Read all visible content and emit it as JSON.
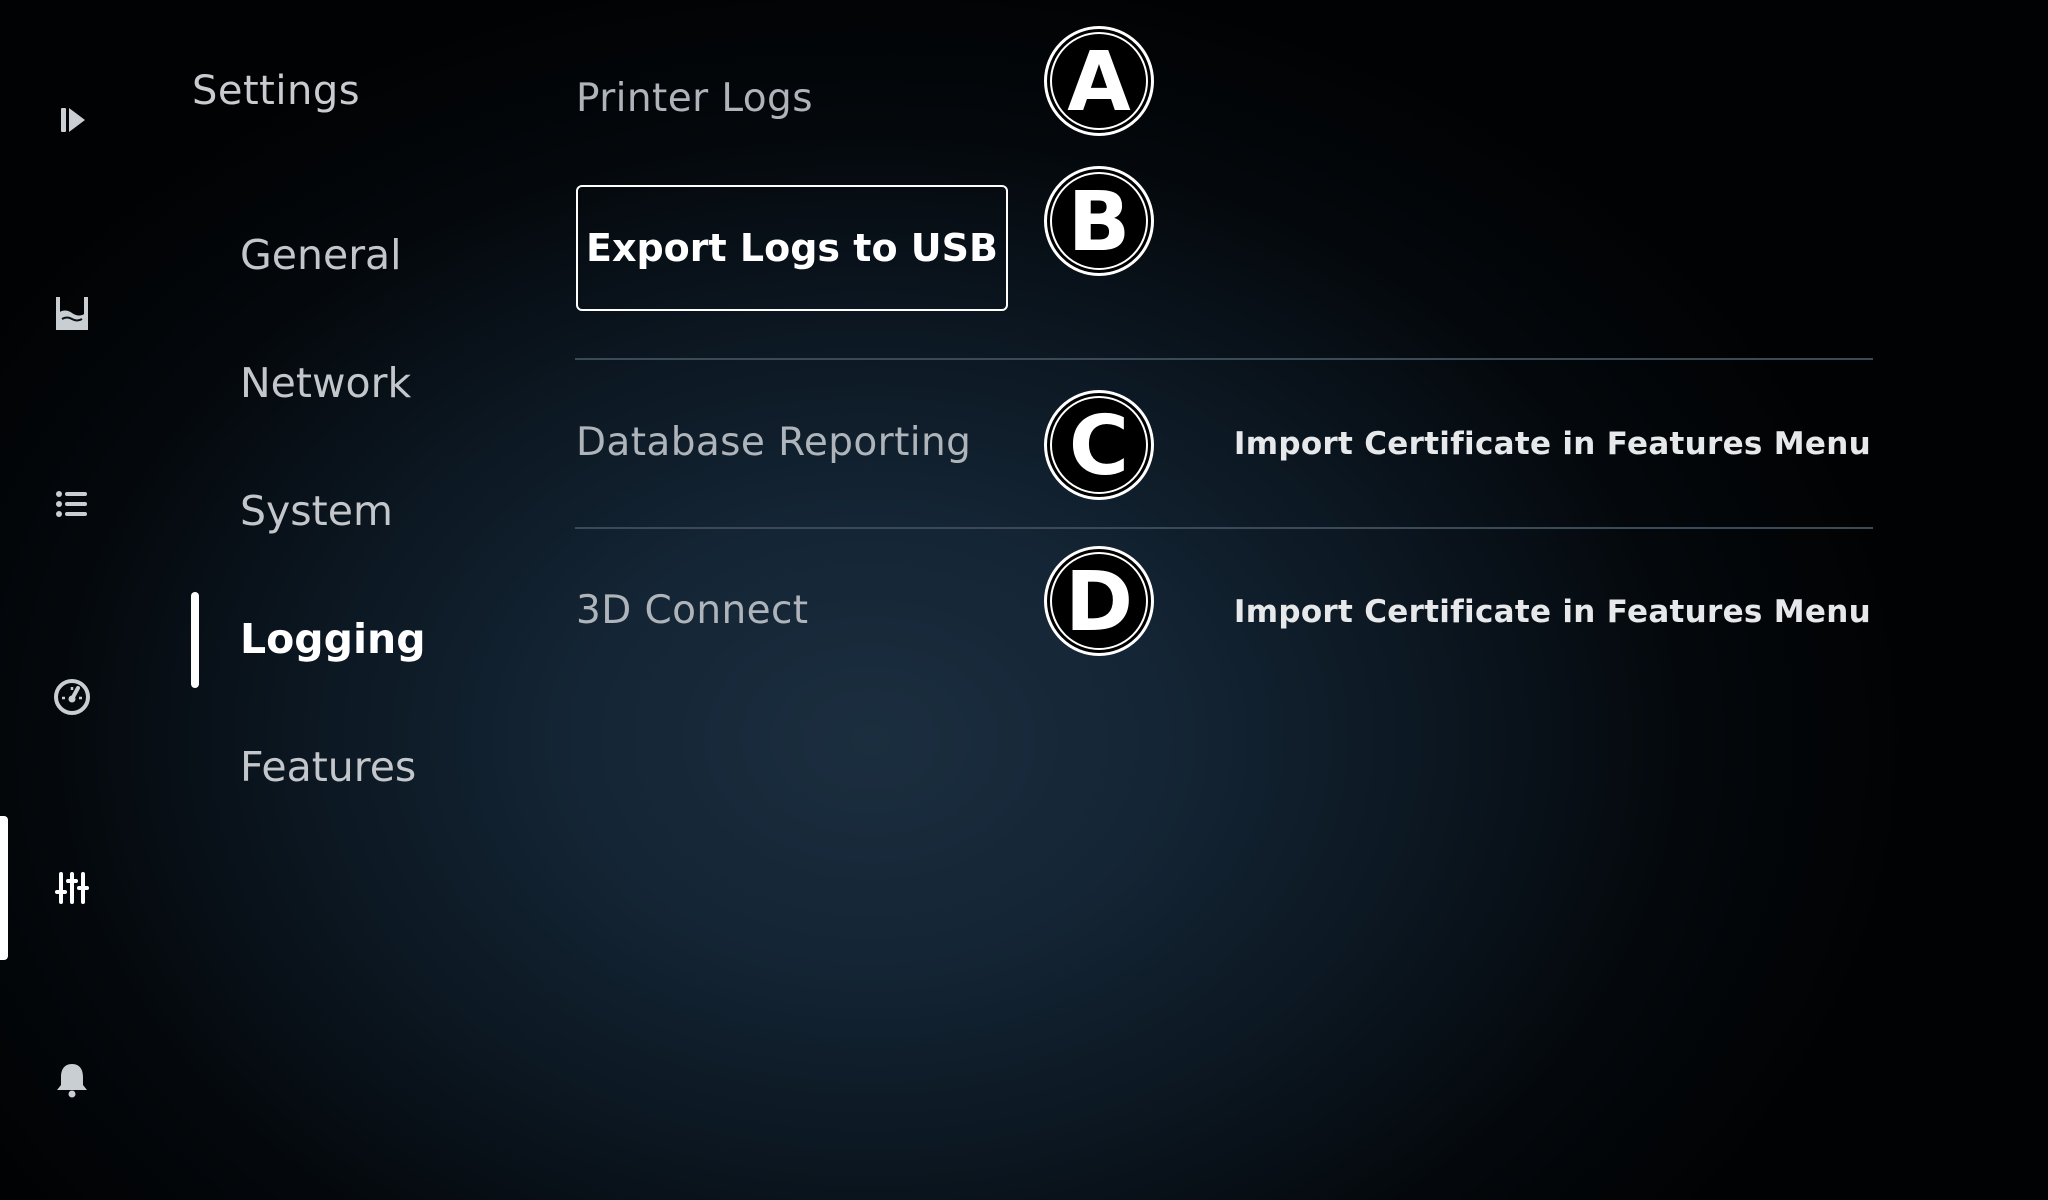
{
  "sidebar_rail": {
    "items": [
      {
        "icon": "play-next-icon"
      },
      {
        "icon": "tank-icon"
      },
      {
        "icon": "list-icon"
      },
      {
        "icon": "gauge-icon"
      },
      {
        "icon": "sliders-icon",
        "active": true
      },
      {
        "icon": "bell-icon"
      }
    ]
  },
  "settings": {
    "title": "Settings",
    "nav": [
      {
        "label": "General"
      },
      {
        "label": "Network"
      },
      {
        "label": "System"
      },
      {
        "label": "Logging",
        "active": true
      },
      {
        "label": "Features"
      }
    ]
  },
  "main": {
    "printer_logs": {
      "label": "Printer Logs",
      "button_label": "Export Logs to USB"
    },
    "database_reporting": {
      "label": "Database Reporting",
      "value": "Import Certificate in Features Menu"
    },
    "connect_3d": {
      "label": "3D Connect",
      "value": "Import Certificate in Features Menu"
    }
  },
  "markers": [
    "A",
    "B",
    "C",
    "D"
  ],
  "colors": {
    "text_active": "#ffffff",
    "text_muted": "#aeb4ba",
    "divider": "#3a4a57",
    "background_center": "#1b2e3f"
  }
}
